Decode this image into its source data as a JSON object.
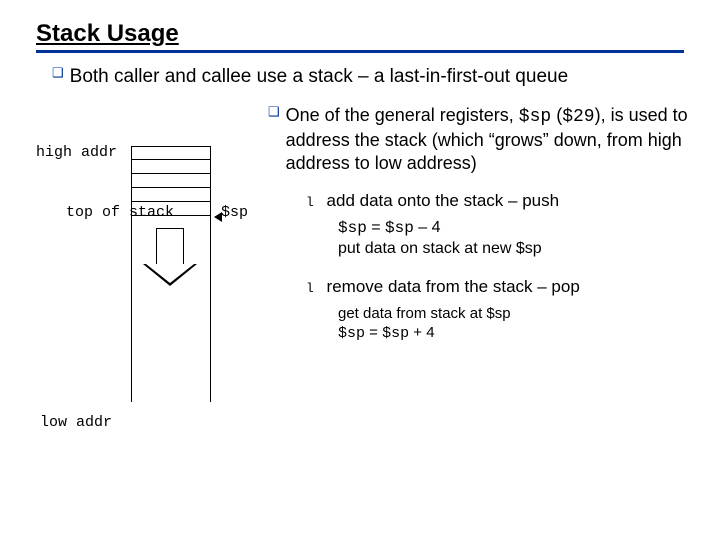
{
  "title": "Stack Usage",
  "main_bullet": "Both caller and callee use a stack – a last-in-first-out queue",
  "diagram": {
    "high_label": "high addr",
    "low_label": "low addr",
    "top_label": "top of stack",
    "sp_label": "$sp"
  },
  "para1_pre": "One of the general registers, ",
  "para1_sp": "$sp",
  "para1_mid": " (",
  "para1_reg": "$29",
  "para1_post": "), is used to address the stack (which “grows” down, from high address to low address)",
  "push_text": "add data onto the stack – push",
  "push_code_a_lhs": "$sp",
  "push_code_a_mid": " = ",
  "push_code_a_rhs": "$sp",
  "push_code_a_end": " – 4",
  "push_code_b": "put data on stack at new $sp",
  "pop_text": "remove data from the stack – pop",
  "pop_code_a": "get data from stack at $sp",
  "pop_code_b_lhs": "$sp",
  "pop_code_b_mid": " = ",
  "pop_code_b_rhs": "$sp",
  "pop_code_b_end": " + 4"
}
